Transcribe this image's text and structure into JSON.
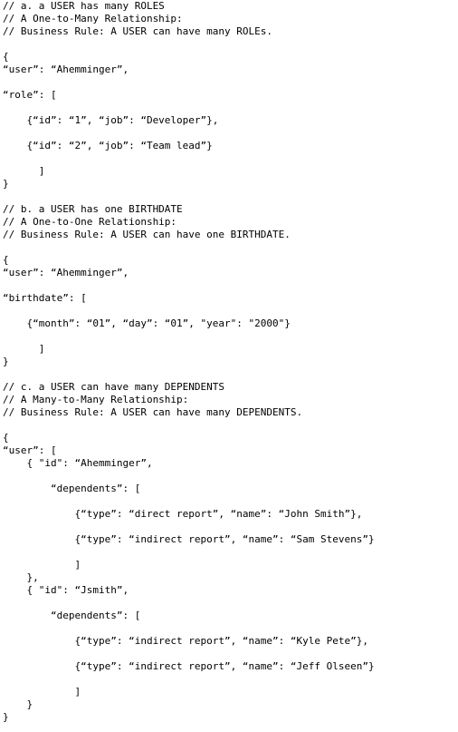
{
  "document": {
    "lines": [
      "// a. a USER has many ROLES",
      "// A One-to-Many Relationship:",
      "// Business Rule: A USER can have many ROLEs.",
      "",
      "{",
      "“user”: “Ahemminger”,",
      "",
      "“role”: [",
      "",
      "    {“id”: “1”, “job”: “Developer”},",
      "",
      "    {“id”: “2”, “job”: “Team lead”}",
      "",
      "      ]",
      "}",
      "",
      "// b. a USER has one BIRTHDATE",
      "// A One-to-One Relationship:",
      "// Business Rule: A USER can have one BIRTHDATE.",
      "",
      "{",
      "“user”: “Ahemminger”,",
      "",
      "“birthdate”: [",
      "",
      "    {“month”: “01”, “day”: “01”, \"year\": \"2000\"}",
      "",
      "      ]",
      "}",
      "",
      "// c. a USER can have many DEPENDENTS",
      "// A Many-to-Many Relationship:",
      "// Business Rule: A USER can have many DEPENDENTS.",
      "",
      "{",
      "“user”: [",
      "    { \"id\": “Ahemminger”,",
      "",
      "        “dependents”: [",
      "",
      "            {“type”: “direct report”, “name”: “John Smith”},",
      "",
      "            {“type”: “indirect report”, “name”: “Sam Stevens”}",
      "",
      "            ]",
      "    },",
      "    { \"id\": “Jsmith”,",
      "",
      "        “dependents”: [",
      "",
      "            {“type”: “indirect report”, “name”: “Kyle Pete”},",
      "",
      "            {“type”: “indirect report”, “name”: “Jeff Olseen”}",
      "",
      "            ]",
      "    }",
      "}"
    ]
  }
}
